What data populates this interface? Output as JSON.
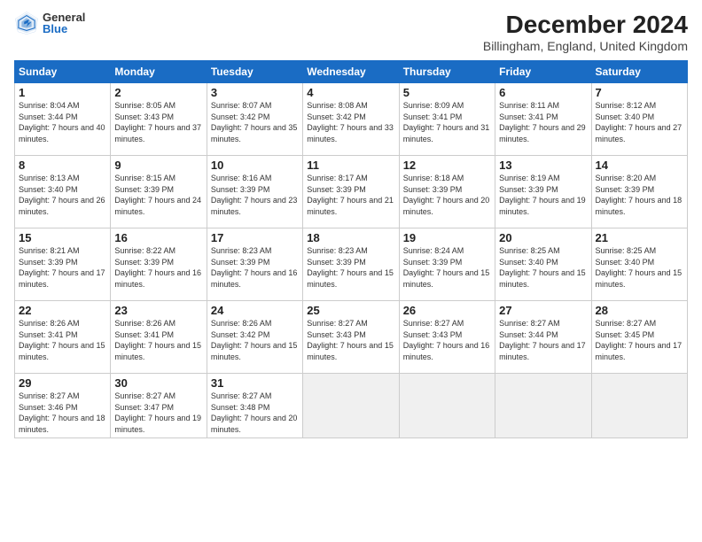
{
  "header": {
    "logo_general": "General",
    "logo_blue": "Blue",
    "main_title": "December 2024",
    "subtitle": "Billingham, England, United Kingdom"
  },
  "days_of_week": [
    "Sunday",
    "Monday",
    "Tuesday",
    "Wednesday",
    "Thursday",
    "Friday",
    "Saturday"
  ],
  "weeks": [
    [
      {
        "day": "1",
        "sunrise": "8:04 AM",
        "sunset": "3:44 PM",
        "daylight": "7 hours and 40 minutes."
      },
      {
        "day": "2",
        "sunrise": "8:05 AM",
        "sunset": "3:43 PM",
        "daylight": "7 hours and 37 minutes."
      },
      {
        "day": "3",
        "sunrise": "8:07 AM",
        "sunset": "3:42 PM",
        "daylight": "7 hours and 35 minutes."
      },
      {
        "day": "4",
        "sunrise": "8:08 AM",
        "sunset": "3:42 PM",
        "daylight": "7 hours and 33 minutes."
      },
      {
        "day": "5",
        "sunrise": "8:09 AM",
        "sunset": "3:41 PM",
        "daylight": "7 hours and 31 minutes."
      },
      {
        "day": "6",
        "sunrise": "8:11 AM",
        "sunset": "3:41 PM",
        "daylight": "7 hours and 29 minutes."
      },
      {
        "day": "7",
        "sunrise": "8:12 AM",
        "sunset": "3:40 PM",
        "daylight": "7 hours and 27 minutes."
      }
    ],
    [
      {
        "day": "8",
        "sunrise": "8:13 AM",
        "sunset": "3:40 PM",
        "daylight": "7 hours and 26 minutes."
      },
      {
        "day": "9",
        "sunrise": "8:15 AM",
        "sunset": "3:39 PM",
        "daylight": "7 hours and 24 minutes."
      },
      {
        "day": "10",
        "sunrise": "8:16 AM",
        "sunset": "3:39 PM",
        "daylight": "7 hours and 23 minutes."
      },
      {
        "day": "11",
        "sunrise": "8:17 AM",
        "sunset": "3:39 PM",
        "daylight": "7 hours and 21 minutes."
      },
      {
        "day": "12",
        "sunrise": "8:18 AM",
        "sunset": "3:39 PM",
        "daylight": "7 hours and 20 minutes."
      },
      {
        "day": "13",
        "sunrise": "8:19 AM",
        "sunset": "3:39 PM",
        "daylight": "7 hours and 19 minutes."
      },
      {
        "day": "14",
        "sunrise": "8:20 AM",
        "sunset": "3:39 PM",
        "daylight": "7 hours and 18 minutes."
      }
    ],
    [
      {
        "day": "15",
        "sunrise": "8:21 AM",
        "sunset": "3:39 PM",
        "daylight": "7 hours and 17 minutes."
      },
      {
        "day": "16",
        "sunrise": "8:22 AM",
        "sunset": "3:39 PM",
        "daylight": "7 hours and 16 minutes."
      },
      {
        "day": "17",
        "sunrise": "8:23 AM",
        "sunset": "3:39 PM",
        "daylight": "7 hours and 16 minutes."
      },
      {
        "day": "18",
        "sunrise": "8:23 AM",
        "sunset": "3:39 PM",
        "daylight": "7 hours and 15 minutes."
      },
      {
        "day": "19",
        "sunrise": "8:24 AM",
        "sunset": "3:39 PM",
        "daylight": "7 hours and 15 minutes."
      },
      {
        "day": "20",
        "sunrise": "8:25 AM",
        "sunset": "3:40 PM",
        "daylight": "7 hours and 15 minutes."
      },
      {
        "day": "21",
        "sunrise": "8:25 AM",
        "sunset": "3:40 PM",
        "daylight": "7 hours and 15 minutes."
      }
    ],
    [
      {
        "day": "22",
        "sunrise": "8:26 AM",
        "sunset": "3:41 PM",
        "daylight": "7 hours and 15 minutes."
      },
      {
        "day": "23",
        "sunrise": "8:26 AM",
        "sunset": "3:41 PM",
        "daylight": "7 hours and 15 minutes."
      },
      {
        "day": "24",
        "sunrise": "8:26 AM",
        "sunset": "3:42 PM",
        "daylight": "7 hours and 15 minutes."
      },
      {
        "day": "25",
        "sunrise": "8:27 AM",
        "sunset": "3:43 PM",
        "daylight": "7 hours and 15 minutes."
      },
      {
        "day": "26",
        "sunrise": "8:27 AM",
        "sunset": "3:43 PM",
        "daylight": "7 hours and 16 minutes."
      },
      {
        "day": "27",
        "sunrise": "8:27 AM",
        "sunset": "3:44 PM",
        "daylight": "7 hours and 17 minutes."
      },
      {
        "day": "28",
        "sunrise": "8:27 AM",
        "sunset": "3:45 PM",
        "daylight": "7 hours and 17 minutes."
      }
    ],
    [
      {
        "day": "29",
        "sunrise": "8:27 AM",
        "sunset": "3:46 PM",
        "daylight": "7 hours and 18 minutes."
      },
      {
        "day": "30",
        "sunrise": "8:27 AM",
        "sunset": "3:47 PM",
        "daylight": "7 hours and 19 minutes."
      },
      {
        "day": "31",
        "sunrise": "8:27 AM",
        "sunset": "3:48 PM",
        "daylight": "7 hours and 20 minutes."
      },
      null,
      null,
      null,
      null
    ]
  ]
}
